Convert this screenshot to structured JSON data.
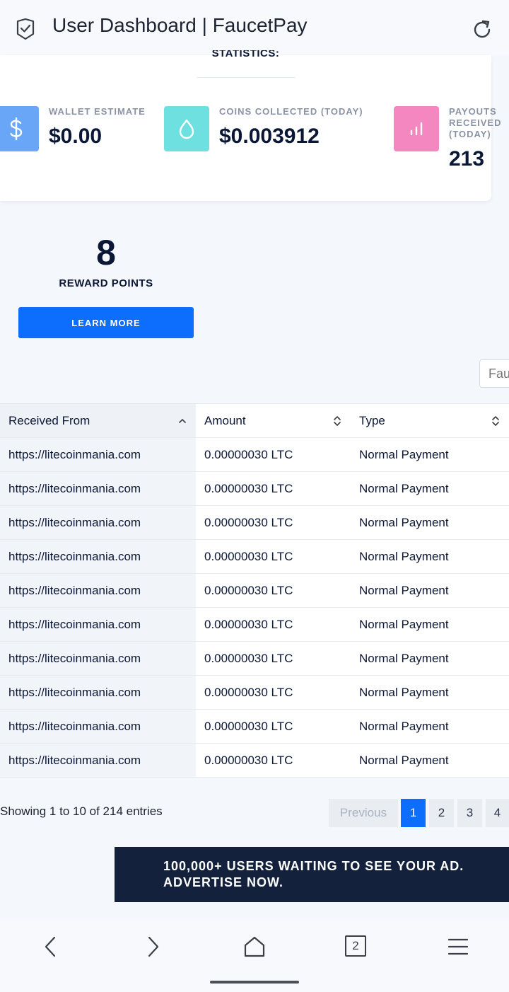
{
  "page": {
    "title": "User Dashboard | FaucetPay"
  },
  "statistics": {
    "heading": "STATISTICS:",
    "wallet": {
      "label": "WALLET ESTIMATE",
      "value": "$0.00",
      "icon": "dollar-icon",
      "color": "#6aa6f7"
    },
    "coins": {
      "label": "COINS COLLECTED (TODAY)",
      "value": "$0.003912",
      "icon": "drop-icon",
      "color": "#6fe0e0"
    },
    "payouts": {
      "label_lines": [
        "PAYOUTS",
        "RECEIVED",
        "(TODAY)"
      ],
      "value": "213",
      "icon": "bar-chart-icon",
      "color": "#f486c0"
    }
  },
  "rewards": {
    "points": "8",
    "label": "REWARD POINTS",
    "button": "LEARN MORE"
  },
  "search": {
    "placeholder": "Faucet"
  },
  "table": {
    "headers": [
      "Received From",
      "Amount",
      "Type"
    ],
    "rows": [
      [
        "https://litecoinmania.com",
        "0.00000030 LTC",
        "Normal Payment"
      ],
      [
        "https://litecoinmania.com",
        "0.00000030 LTC",
        "Normal Payment"
      ],
      [
        "https://litecoinmania.com",
        "0.00000030 LTC",
        "Normal Payment"
      ],
      [
        "https://litecoinmania.com",
        "0.00000030 LTC",
        "Normal Payment"
      ],
      [
        "https://litecoinmania.com",
        "0.00000030 LTC",
        "Normal Payment"
      ],
      [
        "https://litecoinmania.com",
        "0.00000030 LTC",
        "Normal Payment"
      ],
      [
        "https://litecoinmania.com",
        "0.00000030 LTC",
        "Normal Payment"
      ],
      [
        "https://litecoinmania.com",
        "0.00000030 LTC",
        "Normal Payment"
      ],
      [
        "https://litecoinmania.com",
        "0.00000030 LTC",
        "Normal Payment"
      ],
      [
        "https://litecoinmania.com",
        "0.00000030 LTC",
        "Normal Payment"
      ]
    ],
    "info": "Showing 1 to 10 of 214 entries"
  },
  "pagination": {
    "previous": "Previous",
    "pages": [
      "1",
      "2",
      "3",
      "4"
    ],
    "active": "1"
  },
  "ad": {
    "line1": "100,000+ USERS WAITING TO SEE YOUR AD.",
    "line2": "ADVERTISE NOW."
  },
  "browser_nav": {
    "tab_count": "2"
  }
}
